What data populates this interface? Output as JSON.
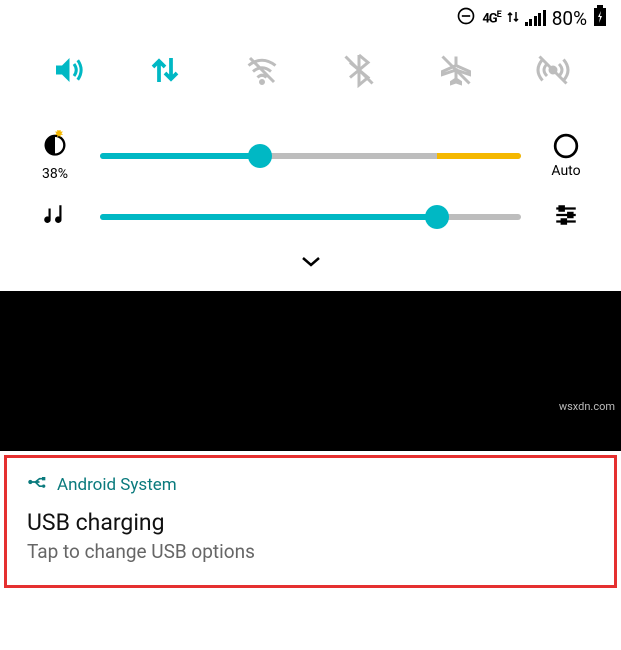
{
  "status": {
    "network_label": "4G",
    "battery_percent": "80%"
  },
  "brightness": {
    "percent_label": "38%",
    "value": 38,
    "auto_label": "Auto"
  },
  "volume": {
    "value": 80
  },
  "notification": {
    "app": "Android System",
    "title": "USB charging",
    "body": "Tap to change USB options"
  },
  "watermark": "wsxdn.com"
}
